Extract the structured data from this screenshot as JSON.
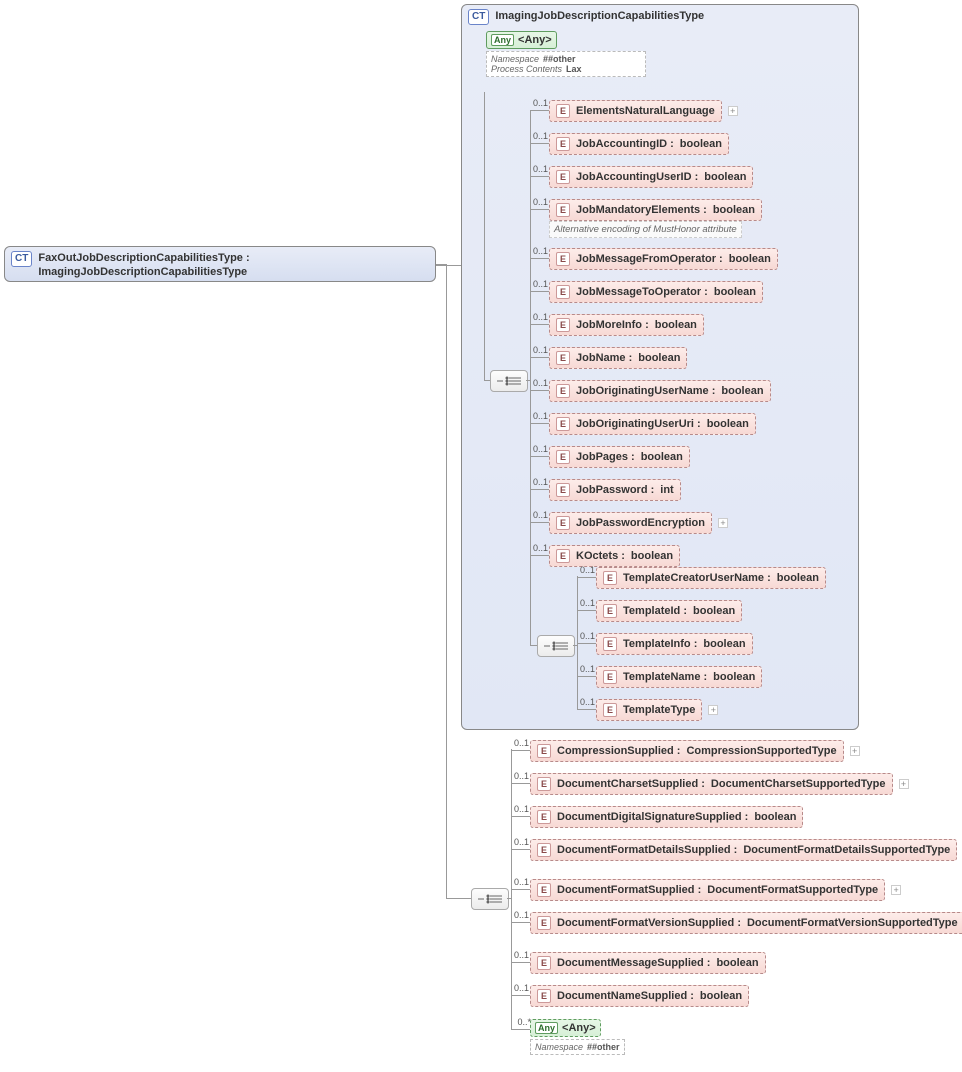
{
  "root": {
    "ct_label": "CT",
    "name": "FaxOutJobDescriptionCapabilitiesType",
    "base_type": "ImagingJobDescriptionCapabilitiesType"
  },
  "inner_ct": {
    "ct_label": "CT",
    "name": "ImagingJobDescriptionCapabilitiesType",
    "any": {
      "badge": "Any",
      "text": "<Any>",
      "namespace_k": "Namespace",
      "namespace_v": "##other",
      "process_k": "Process Contents",
      "process_v": "Lax"
    }
  },
  "e_badge": "E",
  "group1": [
    {
      "name": "ElementsNaturalLanguage",
      "type": "",
      "occ": "0..1",
      "expand": true
    },
    {
      "name": "JobAccountingID",
      "type": "boolean",
      "occ": "0..1"
    },
    {
      "name": "JobAccountingUserID",
      "type": "boolean",
      "occ": "0..1"
    },
    {
      "name": "JobMandatoryElements",
      "type": "boolean",
      "occ": "0..1",
      "annotation": "Alternative encoding of MustHonor attribute"
    },
    {
      "name": "JobMessageFromOperator",
      "type": "boolean",
      "occ": "0..1"
    },
    {
      "name": "JobMessageToOperator",
      "type": "boolean",
      "occ": "0..1"
    },
    {
      "name": "JobMoreInfo",
      "type": "boolean",
      "occ": "0..1"
    },
    {
      "name": "JobName",
      "type": "boolean",
      "occ": "0..1"
    },
    {
      "name": "JobOriginatingUserName",
      "type": "boolean",
      "occ": "0..1"
    },
    {
      "name": "JobOriginatingUserUri",
      "type": "boolean",
      "occ": "0..1"
    },
    {
      "name": "JobPages",
      "type": "boolean",
      "occ": "0..1"
    },
    {
      "name": "JobPassword",
      "type": "int",
      "occ": "0..1"
    },
    {
      "name": "JobPasswordEncryption",
      "type": "",
      "occ": "0..1",
      "expand": true
    },
    {
      "name": "KOctets ",
      "type": "boolean",
      "occ": "0..1"
    }
  ],
  "group1b": [
    {
      "name": "TemplateCreatorUserName",
      "type": "boolean",
      "occ": "0..1"
    },
    {
      "name": "TemplateId",
      "type": "boolean",
      "occ": "0..1"
    },
    {
      "name": "TemplateInfo",
      "type": "boolean",
      "occ": "0..1"
    },
    {
      "name": "TemplateName",
      "type": "boolean",
      "occ": "0..1"
    },
    {
      "name": "TemplateType",
      "type": "",
      "occ": "0..1",
      "expand": true
    }
  ],
  "group2": [
    {
      "name": "CompressionSupplied",
      "type": "CompressionSupportedType",
      "occ": "0..1",
      "expand": true
    },
    {
      "name": "DocumentCharsetSupplied",
      "type": "DocumentCharsetSupportedType",
      "occ": "0..1",
      "expand": true
    },
    {
      "name": "DocumentDigitalSignatureSupplied",
      "type": "boolean",
      "occ": "0..1"
    },
    {
      "name": "DocumentFormatDetailsSupplied",
      "type": "DocumentFormatDetailsSupportedType",
      "occ": "0..1",
      "expand": true,
      "tall": true
    },
    {
      "name": "DocumentFormatSupplied",
      "type": "DocumentFormatSupportedType",
      "occ": "0..1",
      "expand": true
    },
    {
      "name": "DocumentFormatVersionSupplied",
      "type": "DocumentFormatVersionSupportedType",
      "occ": "0..1",
      "expand": true,
      "tall": true
    },
    {
      "name": "DocumentMessageSupplied",
      "type": "boolean",
      "occ": "0..1"
    },
    {
      "name": "DocumentNameSupplied",
      "type": "boolean",
      "occ": "0..1"
    }
  ],
  "any2": {
    "badge": "Any",
    "text": "<Any>",
    "occ": "0..*",
    "namespace_k": "Namespace",
    "namespace_v": "##other"
  }
}
